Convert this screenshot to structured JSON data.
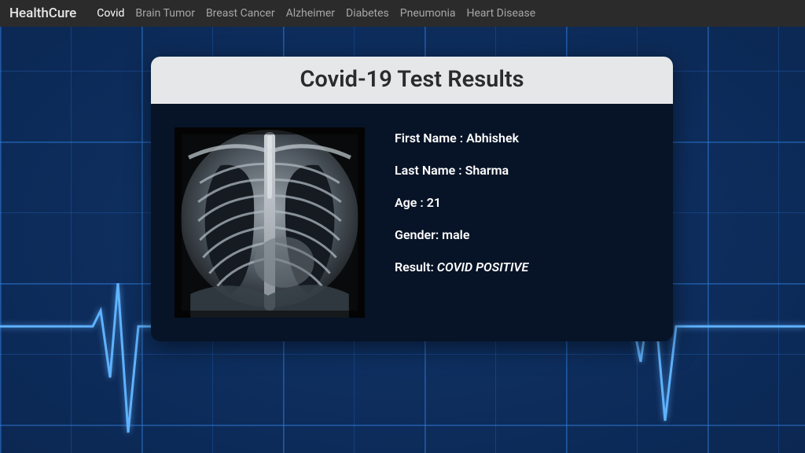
{
  "brand": "HealthCure",
  "nav": {
    "items": [
      {
        "label": "Covid",
        "active": true
      },
      {
        "label": "Brain Tumor",
        "active": false
      },
      {
        "label": "Breast Cancer",
        "active": false
      },
      {
        "label": "Alzheimer",
        "active": false
      },
      {
        "label": "Diabetes",
        "active": false
      },
      {
        "label": "Pneumonia",
        "active": false
      },
      {
        "label": "Heart Disease",
        "active": false
      }
    ]
  },
  "card": {
    "title": "Covid-19 Test Results",
    "labels": {
      "first_name": "First Name : ",
      "last_name": "Last Name : ",
      "age": "Age : ",
      "gender": "Gender: ",
      "result": "Result: "
    },
    "patient": {
      "first_name": "Abhishek",
      "last_name": "Sharma",
      "age": "21",
      "gender": "male",
      "result": "COVID POSITIVE"
    }
  }
}
